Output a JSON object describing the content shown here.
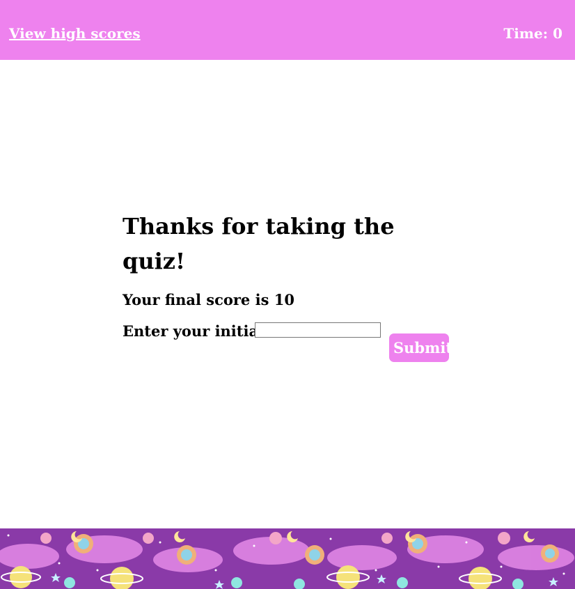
{
  "header": {
    "high_scores_link": "View high scores",
    "timer": "Time: 0"
  },
  "quiz_end": {
    "title": "Thanks for taking the quiz!",
    "final_score": "Your final score is 10",
    "initials_label": "Enter your initials:",
    "initials_value": "",
    "submit_label": "Submit"
  },
  "colors": {
    "accent": "#ee82ee",
    "footer_bg": "#8a3aa8",
    "text": "#000000"
  },
  "icons": {
    "footer_pattern": "space-planets-pattern"
  }
}
